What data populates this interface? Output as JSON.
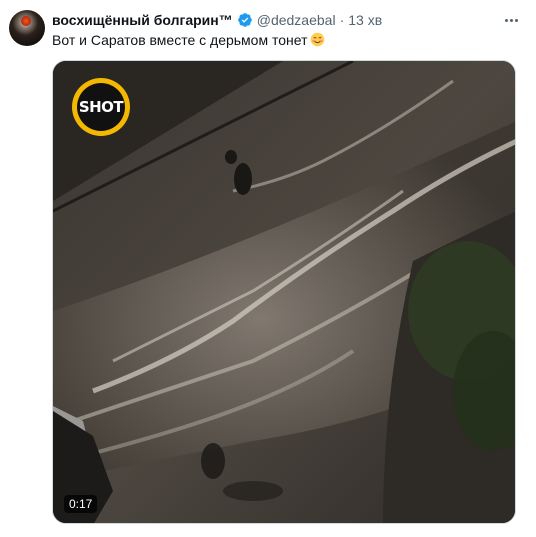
{
  "tweet": {
    "author": {
      "display_name": "восхищённый болгарин™",
      "verified": true,
      "handle": "@dedzaebal"
    },
    "separator": "·",
    "time": "13 хв",
    "text": "Вот и Саратов вместе с дерьмом тонет",
    "emoji": "smiling-face-with-blush",
    "media": {
      "type": "video",
      "watermark": "SHOT",
      "duration": "0:17"
    }
  },
  "colors": {
    "text_primary": "#0f1419",
    "text_secondary": "#536471",
    "verified": "#1d9bf0",
    "shot_logo": "#f5b800"
  },
  "icons": [
    "verified-badge-icon",
    "more-options-icon",
    "blush-emoji-icon",
    "shot-logo-icon"
  ]
}
